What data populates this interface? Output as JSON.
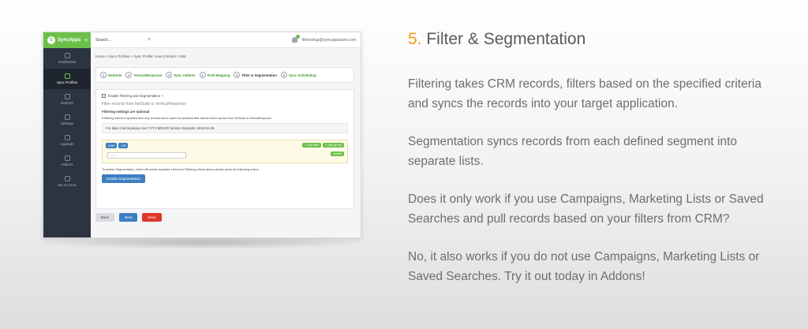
{
  "section": {
    "number": "5.",
    "title": "Filter & Segmentation"
  },
  "paragraphs": [
    "Filtering takes CRM records, filters based on the specified criteria and syncs the records into your target application.",
    "Segmentation syncs records from each defined segment into separate lists.",
    "Does it only work if you use Campaigns, Marketing Lists or Saved Searches and pull records based on your filters from CRM?",
    "No, it also works if you do not use Campaigns, Marketing Lists or Saved Searches. Try it out today in Addons!"
  ],
  "colors": {
    "accent_number": "#f39a1e",
    "brand_green": "#6cc04a",
    "sidebar": "#2c3440"
  },
  "mockup": {
    "logo": "SyncApps",
    "search_placeholder": "Search...",
    "user": "filtersetup@syncappsuser.com",
    "sidebar": [
      {
        "label": "Dashboard",
        "icon": "dashboard-icon"
      },
      {
        "label": "Sync Profiles",
        "icon": "sync-icon",
        "active": true
      },
      {
        "label": "Reports",
        "icon": "reports-icon"
      },
      {
        "label": "Settings",
        "icon": "gear-icon"
      },
      {
        "label": "Upgrade",
        "icon": "upgrade-icon"
      },
      {
        "label": "Addons",
        "icon": "addons-icon"
      },
      {
        "label": "My Account",
        "icon": "account-icon"
      }
    ],
    "breadcrumb": "Home > Sync Profiles > Sync Profile: How It Works > Edit",
    "steps": [
      {
        "num": "1",
        "label": "NetSuite"
      },
      {
        "num": "2",
        "label": "VerticalResponse"
      },
      {
        "num": "3",
        "label": "Sync Addons"
      },
      {
        "num": "4",
        "label": "Field Mapping"
      },
      {
        "num": "5",
        "label": "Filter & Segmentation"
      },
      {
        "num": "6",
        "label": "Sync Scheduling"
      }
    ],
    "enable_label": "Enable Filtering and Segmentation",
    "filter_records_label": "Filter records from NetSuite to VerticalResponse",
    "optional_note": "Filtering settings are optional",
    "criteria_note": "If filtering criteria is specified then only records which match the specified filter criteria will be synced from NetSuite to VerticalResponse",
    "date_note": "For date criteria please use YYYY-MM-DD format. Example: 2015-01-25.",
    "and_label": "AND",
    "or_label": "OR",
    "add_filter_label": "+ Add filter",
    "add_group_label": "+ Add group",
    "delete_label": "Delete",
    "select_placeholder": "-------",
    "segmentation_note": "To enable Segmentation, which will create separate Lists from Filtering criteria above please press the following button",
    "enable_segmentation_label": "Enable Segmentation",
    "back_label": "Back",
    "next_label": "Next",
    "save_label": "Save"
  }
}
